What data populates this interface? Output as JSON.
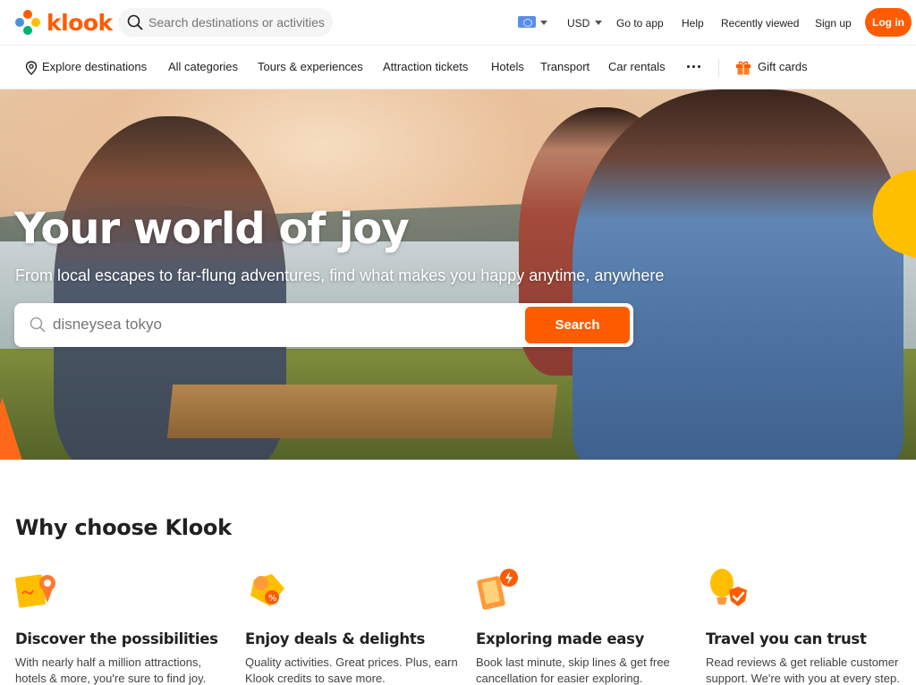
{
  "brand": {
    "name": "klook",
    "accent": "#ff5b00"
  },
  "header": {
    "search_placeholder": "Search destinations or activities",
    "language_icon": "flag-icon",
    "currency": "USD",
    "links": [
      "Go to app",
      "Help",
      "Recently viewed",
      "Sign up"
    ],
    "login_label": "Log in"
  },
  "categories": {
    "explore": "Explore destinations",
    "items": [
      "All categories",
      "Tours & experiences",
      "Attraction tickets",
      "Hotels",
      "Transport",
      "Car rentals"
    ],
    "gift_cards": "Gift cards"
  },
  "hero": {
    "title": "Your world of joy",
    "subtitle": "From local escapes to far-flung adventures, find what makes you happy anytime, anywhere",
    "search_value": "disneysea tokyo",
    "search_button": "Search"
  },
  "why": {
    "title": "Why choose Klook",
    "features": [
      {
        "icon": "map-pin-icon",
        "title": "Discover the possibilities",
        "desc": "With nearly half a million attractions, hotels & more, you're sure to find joy."
      },
      {
        "icon": "deal-tag-icon",
        "title": "Enjoy deals & delights",
        "desc": "Quality activities. Great prices. Plus, earn Klook credits to save more."
      },
      {
        "icon": "phone-lightning-icon",
        "title": "Exploring made easy",
        "desc": "Book last minute, skip lines & get free cancellation for easier exploring."
      },
      {
        "icon": "balloon-shield-icon",
        "title": "Travel you can trust",
        "desc": "Read reviews & get reliable customer support. We're with you at every step."
      }
    ]
  }
}
